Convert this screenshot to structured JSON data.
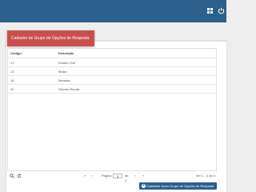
{
  "header": {
    "grid_icon": "grid-icon",
    "power_icon": "power-icon",
    "color": "#2d5f8c"
  },
  "card": {
    "title": "Cadastro de Grupo de Opções de Resposta",
    "title_color": "#c94f4f"
  },
  "table": {
    "columns": [
      "Código",
      "Descrição"
    ],
    "rows": [
      {
        "code": "17",
        "description": "Estado Civil"
      },
      {
        "code": "13",
        "description": "Mídia"
      },
      {
        "code": "15",
        "description": "Moradia"
      },
      {
        "code": "20",
        "description": "Valores Renda"
      }
    ]
  },
  "pager": {
    "first": "⇤",
    "prev": "«",
    "page_label": "Página",
    "page_value": "1",
    "of_label": "de 1",
    "next": "»",
    "last": "⇥",
    "view_info": "Ver 1 - 4 de 4"
  },
  "toolbar": {
    "search_icon": "search-icon",
    "refresh_icon": "refresh-icon"
  },
  "add_button": {
    "label": "Cadastrar Novo Grupo de Opções de Resposta"
  }
}
